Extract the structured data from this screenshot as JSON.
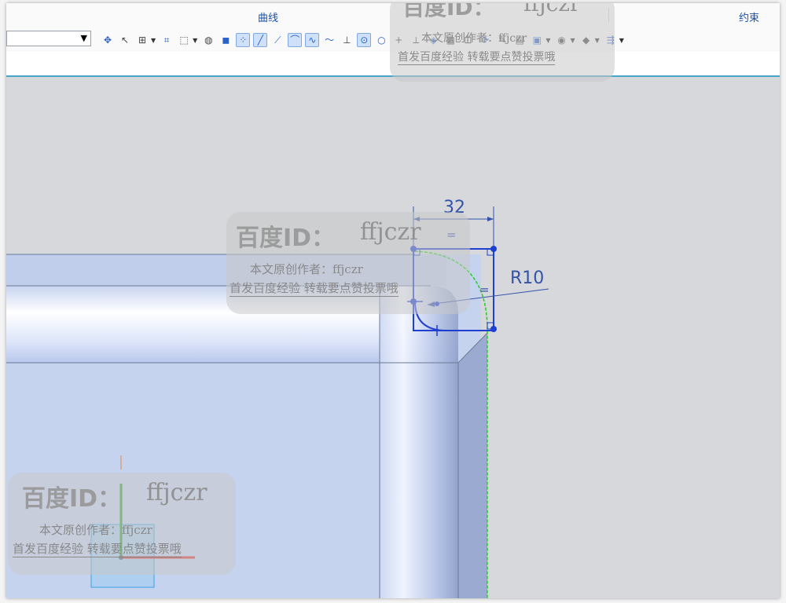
{
  "ribbon": {
    "group_curves": "曲线",
    "group_constraints": "约束"
  },
  "toolbar": {
    "selection_filter_value": "",
    "tools": [
      {
        "icon": "snap-icon",
        "glyph": "✥"
      },
      {
        "icon": "pointer-icon",
        "glyph": "↖"
      },
      {
        "icon": "select-box-icon",
        "glyph": "⊞"
      },
      {
        "icon": "lasso-icon",
        "glyph": "⌗"
      },
      {
        "icon": "rectangle-select-icon",
        "glyph": "⬚"
      },
      {
        "icon": "view-icon",
        "glyph": "◍"
      },
      {
        "icon": "solid-icon",
        "glyph": "◼"
      },
      {
        "icon": "point-snap-icon",
        "glyph": "⁘"
      },
      {
        "icon": "line-icon",
        "glyph": "╱"
      },
      {
        "icon": "line-alt-icon",
        "glyph": "⟋"
      },
      {
        "icon": "arc-icon",
        "glyph": "⌒"
      },
      {
        "icon": "spline-icon",
        "glyph": "∿"
      },
      {
        "icon": "curve-icon",
        "glyph": "〜"
      },
      {
        "icon": "perpendicular-icon",
        "glyph": "⊥"
      },
      {
        "icon": "circle-center-icon",
        "glyph": "⊙"
      },
      {
        "icon": "circle-icon",
        "glyph": "○"
      },
      {
        "icon": "plus-icon",
        "glyph": "+"
      },
      {
        "icon": "tangent-icon",
        "glyph": "⟂"
      },
      {
        "icon": "constraint-icon",
        "glyph": "◈"
      },
      {
        "icon": "table-icon",
        "glyph": "▦"
      },
      {
        "icon": "dimension-icon",
        "glyph": "⊡"
      },
      {
        "icon": "pattern-icon",
        "glyph": "⟳"
      },
      {
        "icon": "paint-icon",
        "glyph": "✎"
      },
      {
        "icon": "layer-icon",
        "glyph": "▤"
      },
      {
        "icon": "grid-icon",
        "glyph": "▣"
      },
      {
        "icon": "palette-icon",
        "glyph": "◉"
      },
      {
        "icon": "render-icon",
        "glyph": "◆"
      },
      {
        "icon": "arrows-icon",
        "glyph": "⇶"
      }
    ]
  },
  "sketch": {
    "width_dimension": "32",
    "radius_dimension": "R10",
    "equal_symbol_top": "=",
    "equal_symbol_right": "="
  },
  "watermarks": [
    {
      "id_label": "百度ID：",
      "user": "ffjczr",
      "line1": "本文原创作者：ffjczr",
      "line2": "首发百度经验 转载要点赞投票哦"
    },
    {
      "id_label": "百度ID：",
      "user": "ffjczr",
      "line1": "本文原创作者：ffjczr",
      "line2": "首发百度经验 转载要点赞投票哦"
    },
    {
      "id_label": "百度ID：",
      "user": "ffjczr",
      "line1": "本文原创作者：ffjczr",
      "line2": "首发百度经验 转载要点赞投票哦"
    }
  ],
  "colors": {
    "accent": "#1a50a8",
    "sketch_blue": "#1f3fd0",
    "model_face": "#c4d2ee",
    "green_edge": "#1fd01f"
  }
}
